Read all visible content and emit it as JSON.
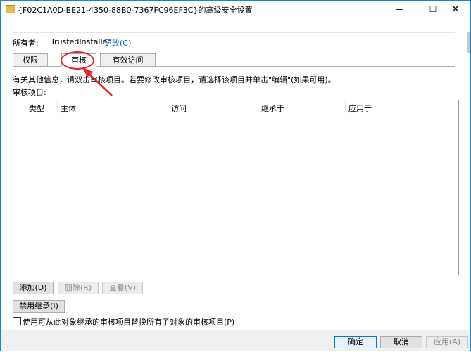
{
  "window": {
    "title": "{F02C1A0D-BE21-4350-88B0-7367FC96EF3C}的高级安全设置",
    "minimize": "—",
    "maximize": "☐",
    "close": "✕"
  },
  "owner": {
    "label": "所有者:",
    "value": "TrustedInstaller",
    "change_link": "更改(C)"
  },
  "tabs": [
    {
      "label": "权限"
    },
    {
      "label": "审核"
    },
    {
      "label": "有效访问"
    }
  ],
  "info_text": "有关其他信息，请双击审核项目。若要修改审核项目，请选择该项目并单击\"编辑\"(如果可用)。",
  "entries_label": "审核项目:",
  "grid": {
    "columns": [
      "类型",
      "主体",
      "访问",
      "继承于",
      "应用于"
    ],
    "rows": []
  },
  "buttons": {
    "add": "添加(D)",
    "remove": "删除(R)",
    "view": "查看(V)",
    "disable_inheritance": "禁用继承(I)"
  },
  "replace_checkbox": {
    "label": "使用可从此对象继承的审核项目替换所有子对象的审核项目(P)",
    "checked": false
  },
  "footer": {
    "ok": "确定",
    "cancel": "取消",
    "apply": "应用(A)"
  },
  "annotation_color": "#e4232a"
}
